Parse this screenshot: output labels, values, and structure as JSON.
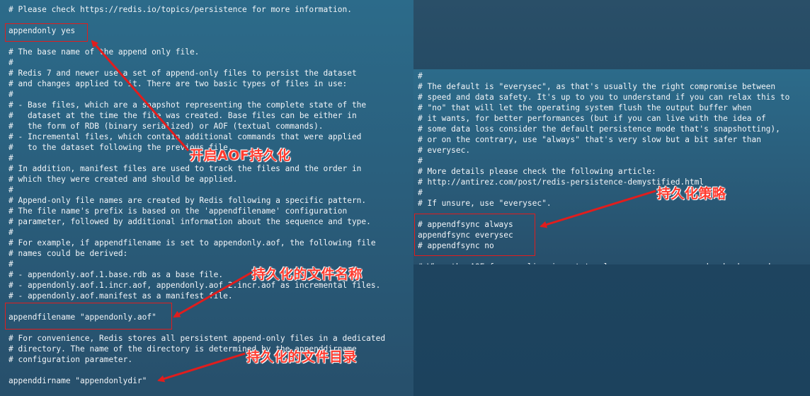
{
  "left_terminal": {
    "lines": [
      "# Please check https://redis.io/topics/persistence for more information.",
      "",
      "appendonly yes",
      "",
      "# The base name of the append only file.",
      "#",
      "# Redis 7 and newer use a set of append-only files to persist the dataset",
      "# and changes applied to it. There are two basic types of files in use:",
      "#",
      "# - Base files, which are a snapshot representing the complete state of the",
      "#   dataset at the time the file was created. Base files can be either in",
      "#   the form of RDB (binary serialized) or AOF (textual commands).",
      "# - Incremental files, which contain additional commands that were applied",
      "#   to the dataset following the previous file.",
      "#",
      "# In addition, manifest files are used to track the files and the order in",
      "# which they were created and should be applied.",
      "#",
      "# Append-only file names are created by Redis following a specific pattern.",
      "# The file name's prefix is based on the 'appendfilename' configuration",
      "# parameter, followed by additional information about the sequence and type.",
      "#",
      "# For example, if appendfilename is set to appendonly.aof, the following file",
      "# names could be derived:",
      "#",
      "# - appendonly.aof.1.base.rdb as a base file.",
      "# - appendonly.aof.1.incr.aof, appendonly.aof.2.incr.aof as incremental files.",
      "# - appendonly.aof.manifest as a manifest file.",
      "",
      "appendfilename \"appendonly.aof\"",
      "",
      "# For convenience, Redis stores all persistent append-only files in a dedicated",
      "# directory. The name of the directory is determined by the appenddirname",
      "# configuration parameter.",
      "",
      "appenddirname \"appendonlydir\""
    ]
  },
  "right_terminal": {
    "lines": [
      "#",
      "# The default is \"everysec\", as that's usually the right compromise between",
      "# speed and data safety. It's up to you to understand if you can relax this to",
      "# \"no\" that will let the operating system flush the output buffer when",
      "# it wants, for better performances (but if you can live with the idea of",
      "# some data loss consider the default persistence mode that's snapshotting),",
      "# or on the contrary, use \"always\" that's very slow but a bit safer than",
      "# everysec.",
      "#",
      "# More details please check the following article:",
      "# http://antirez.com/post/redis-persistence-demystified.html",
      "#",
      "# If unsure, use \"everysec\".",
      "",
      "# appendfsync always",
      "appendfsync everysec",
      "# appendfsync no",
      "",
      "# When the AOF fsync policy is set to always or everysec, and a background"
    ]
  },
  "annotations": {
    "enable_aof": "开启AOF持久化",
    "file_name": "持久化的文件名称",
    "file_dir": "持久化的文件目录",
    "strategy": "持久化策略"
  },
  "colors": {
    "annotation": "#ff3b2f",
    "highlight_box": "#e11d1d",
    "terminal_text": "#f2f5f8"
  }
}
